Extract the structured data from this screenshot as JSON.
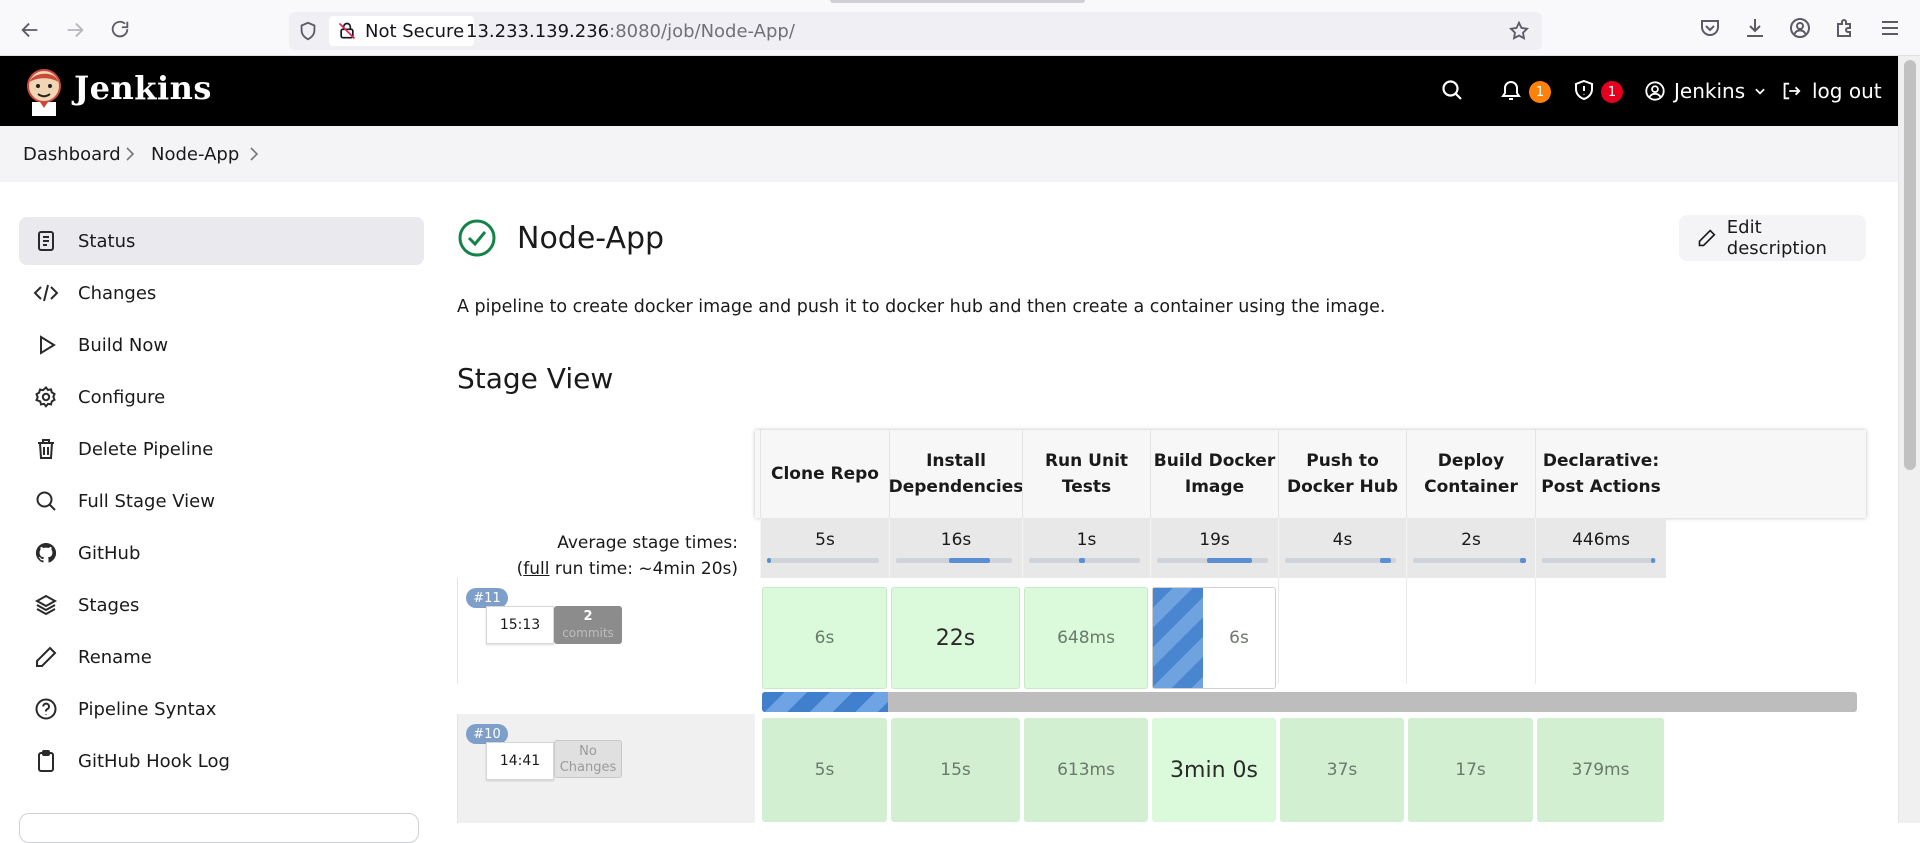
{
  "browser": {
    "security_label": "Not Secure",
    "url_host": "13.233.139.236",
    "url_rest": ":8080/job/Node-App/"
  },
  "header": {
    "brand": "Jenkins",
    "notifications_count": "1",
    "security_count": "1",
    "user_name": "Jenkins",
    "logout_label": "log out",
    "colors": {
      "bar": "#000000",
      "notif_badge": "#fe820a",
      "security_badge": "#e6001f"
    }
  },
  "breadcrumb": [
    "Dashboard",
    "Node-App"
  ],
  "sidebar": {
    "items": [
      {
        "label": "Status",
        "icon": "status-icon",
        "active": true
      },
      {
        "label": "Changes",
        "icon": "code-icon"
      },
      {
        "label": "Build Now",
        "icon": "play-icon"
      },
      {
        "label": "Configure",
        "icon": "gear-icon"
      },
      {
        "label": "Delete Pipeline",
        "icon": "trash-icon"
      },
      {
        "label": "Full Stage View",
        "icon": "search-icon"
      },
      {
        "label": "GitHub",
        "icon": "github-icon"
      },
      {
        "label": "Stages",
        "icon": "layers-icon"
      },
      {
        "label": "Rename",
        "icon": "pencil-icon"
      },
      {
        "label": "Pipeline Syntax",
        "icon": "help-icon"
      },
      {
        "label": "GitHub Hook Log",
        "icon": "clipboard-icon"
      }
    ]
  },
  "main": {
    "title": "Node-App",
    "edit_description_label": "Edit description",
    "description": "A pipeline to create docker image and push it to docker hub and then create a container using the image.",
    "stage_view_title": "Stage View"
  },
  "stage_view": {
    "stages": [
      "Clone Repo",
      "Install Dependencies",
      "Run Unit Tests",
      "Build Docker Image",
      "Push to Docker Hub",
      "Deploy Container",
      "Declarative: Post Actions"
    ],
    "stage_lines": [
      [
        "Clone Repo"
      ],
      [
        "Install",
        "Dependencies"
      ],
      [
        "Run Unit Tests"
      ],
      [
        "Build Docker",
        "Image"
      ],
      [
        "Push to",
        "Docker Hub"
      ],
      [
        "Deploy",
        "Container"
      ],
      [
        "Declarative:",
        "Post Actions"
      ]
    ],
    "avg_label": "Average stage times:",
    "full_run_prefix": "(",
    "full_link": "full",
    "full_run_suffix": " run time: ~4min 20s)",
    "avg_times": [
      "5s",
      "16s",
      "1s",
      "19s",
      "4s",
      "2s",
      "446ms"
    ],
    "avg_bar_fraction": [
      0.0,
      0.35,
      0.05,
      0.4,
      0.1,
      0.05,
      0.02
    ],
    "runs": [
      {
        "number": "#11",
        "time": "15:13",
        "changes": "2",
        "changes_sub": "commits",
        "cells": [
          "6s",
          "22s",
          "648ms",
          "6s",
          "",
          "",
          ""
        ],
        "progress_fraction": 0.115
      },
      {
        "number": "#10",
        "time": "14:41",
        "changes": "No",
        "changes_sub": "Changes",
        "cells": [
          "5s",
          "15s",
          "613ms",
          "3min 0s",
          "37s",
          "17s",
          "379ms"
        ]
      }
    ]
  }
}
